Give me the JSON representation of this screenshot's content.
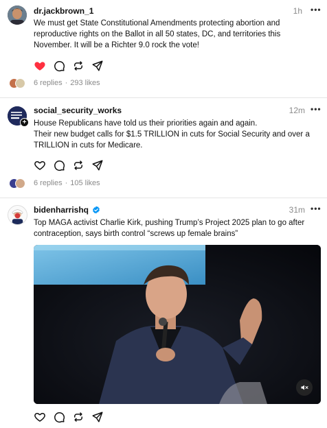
{
  "posts": [
    {
      "username": "dr.jackbrown_1",
      "time": "1h",
      "more": "•••",
      "text": "We must get State Constitutional Amendments protecting abortion and reproductive rights on the Ballot in all 50 states, DC, and territories this November. It will be a Richter 9.0 rock the vote!",
      "liked": true,
      "replies": "6 replies",
      "likes": "293 likes"
    },
    {
      "username": "social_security_works",
      "time": "12m",
      "more": "•••",
      "avatar_text": "SOCIAL SECURITY WORKS",
      "text_line1": "House Republicans have told us their priorities again and again.",
      "text_line2": "Their new budget calls for $1.5 TRILLION in cuts for Social Security and over a TRILLION in cuts for Medicare.",
      "liked": false,
      "replies": "6 replies",
      "likes": "105 likes"
    },
    {
      "username": "biden​harrishq",
      "username_plain": "bidenharrishq",
      "verified": true,
      "time": "31m",
      "more": "•••",
      "text": "Top MAGA activist Charlie Kirk, pushing Trump’s Project 2025 plan to go after contraception, says birth control “screws up female brains”",
      "liked": false,
      "media": "video",
      "muted": true
    }
  ],
  "colors": {
    "like_red": "#ff3040",
    "divider": "#e5e5e5",
    "meta_gray": "#8a8a8a",
    "verified_blue": "#0095f6"
  },
  "icons": [
    "heart-icon",
    "reply-icon",
    "repost-icon",
    "share-icon",
    "more-icon",
    "verified-icon",
    "mute-icon",
    "follow-plus-icon"
  ]
}
